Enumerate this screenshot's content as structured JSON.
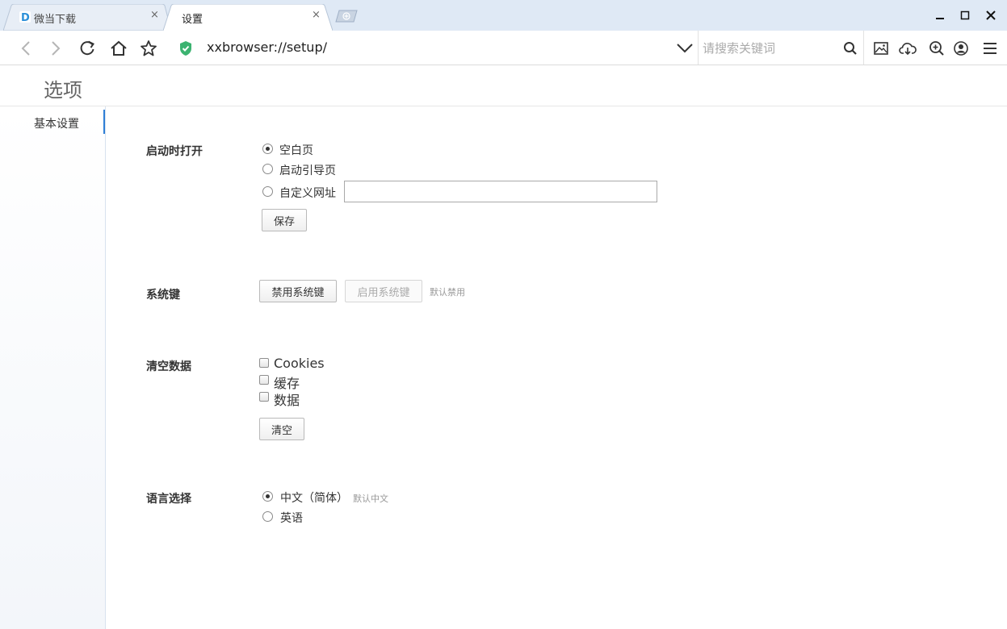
{
  "tabs": [
    {
      "title": "微当下载",
      "close": "×"
    },
    {
      "title": "设置",
      "close": "×"
    }
  ],
  "toolbar": {
    "url": "xxbrowser://setup/",
    "search_placeholder": "请搜索关键词"
  },
  "page": {
    "title": "选项"
  },
  "sidebar": {
    "items": [
      {
        "label": "基本设置"
      }
    ]
  },
  "startup": {
    "label": "启动时打开",
    "options": [
      "空白页",
      "启动引导页",
      "自定义网址"
    ],
    "selected_index": 0,
    "custom_url_value": "",
    "save_label": "保存"
  },
  "system_keys": {
    "label": "系统键",
    "disable_label": "禁用系统键",
    "enable_label": "启用系统键",
    "hint": "默认禁用"
  },
  "clear_data": {
    "label": "清空数据",
    "options": [
      "Cookies",
      "缓存",
      "数据"
    ],
    "clear_label": "清空"
  },
  "language": {
    "label": "语言选择",
    "options": [
      "中文（简体）",
      "英语"
    ],
    "selected_index": 0,
    "hint": "默认中文"
  },
  "colors": {
    "tabstrip_bg": "#dfe9f5",
    "accent": "#2f7fd6",
    "shield": "#3cb371"
  }
}
